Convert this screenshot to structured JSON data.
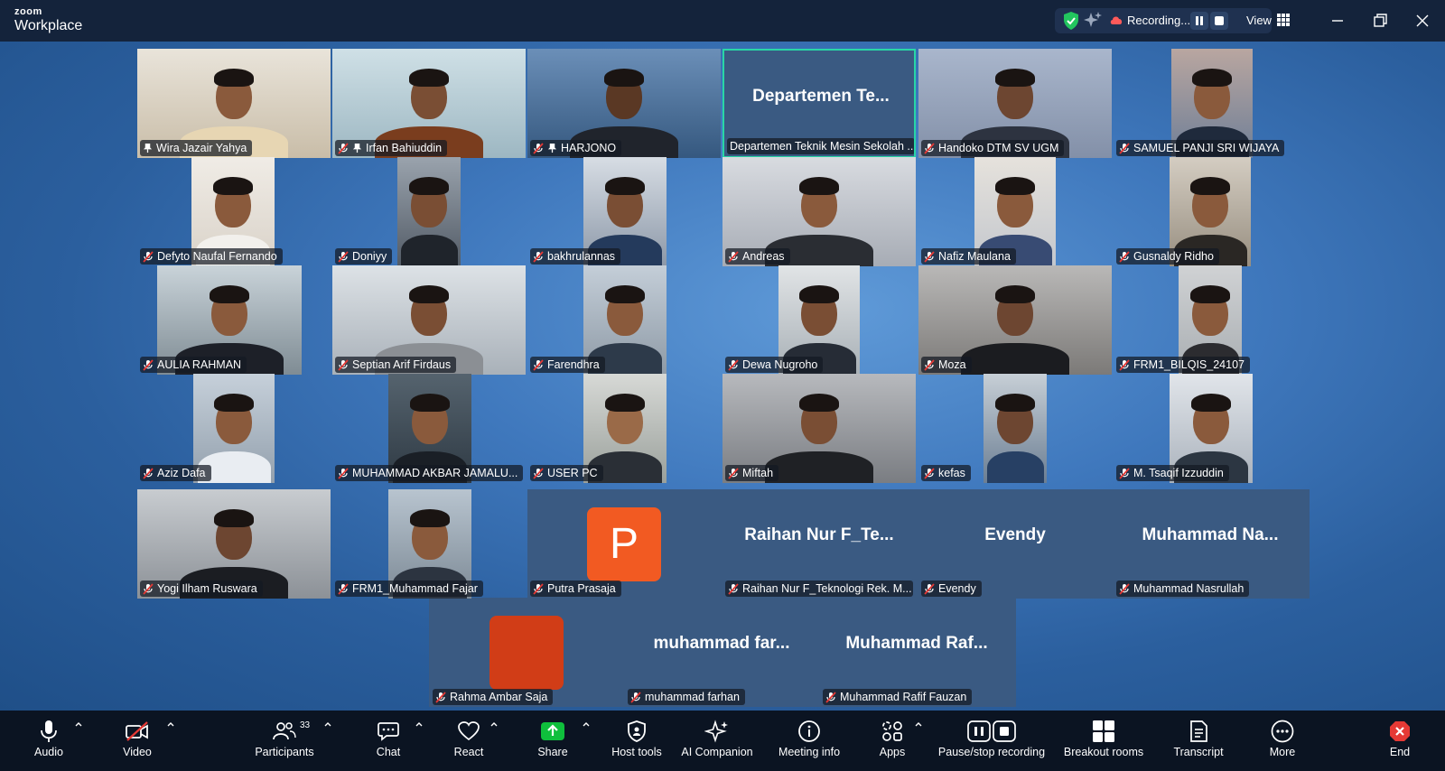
{
  "app": {
    "brand_top": "zoom",
    "brand_bottom": "Workplace"
  },
  "recording": {
    "status": "Recording...",
    "view_label": "View"
  },
  "participants": [
    {
      "name": "Wira Jazair Yahya",
      "pinned": true,
      "muted": false
    },
    {
      "name": "Irfan Bahiuddin",
      "pinned": true,
      "muted": true
    },
    {
      "name": "HARJONO",
      "pinned": true,
      "muted": true
    },
    {
      "name": "Departemen Teknik Mesin Sekolah ...",
      "display": "Departemen  Te...",
      "muted": false,
      "active_speaker": true
    },
    {
      "name": "Handoko DTM SV UGM",
      "muted": true
    },
    {
      "name": "SAMUEL PANJI SRI WIJAYA",
      "muted": true
    },
    {
      "name": "Defyto Naufal Fernando",
      "muted": true
    },
    {
      "name": "Doniyy",
      "muted": true
    },
    {
      "name": "bakhrulannas",
      "muted": true
    },
    {
      "name": "Andreas",
      "muted": true
    },
    {
      "name": "Nafiz Maulana",
      "muted": true
    },
    {
      "name": "Gusnaldy Ridho",
      "muted": true
    },
    {
      "name": "AULIA RAHMAN",
      "muted": true
    },
    {
      "name": "Septian Arif Firdaus",
      "muted": true
    },
    {
      "name": "Farendhra",
      "muted": true
    },
    {
      "name": "Dewa Nugroho",
      "muted": true
    },
    {
      "name": "Moza",
      "muted": true
    },
    {
      "name": "FRM1_BILQIS_24107",
      "muted": true
    },
    {
      "name": "Aziz Dafa",
      "muted": true
    },
    {
      "name": "MUHAMMAD AKBAR JAMALU...",
      "muted": true
    },
    {
      "name": "USER PC",
      "muted": true
    },
    {
      "name": "Miftah",
      "muted": true
    },
    {
      "name": "kefas",
      "muted": true
    },
    {
      "name": "M. Tsaqif Izzuddin",
      "muted": true
    },
    {
      "name": "Yogi Ilham Ruswara",
      "muted": true
    },
    {
      "name": "FRM1_Muhammad Fajar",
      "muted": true
    },
    {
      "name": "Putra Prasaja",
      "avatar_letter": "P",
      "muted": true
    },
    {
      "name": "Raihan Nur F_Teknologi Rek. M...",
      "display": "Raihan  Nur  F_Te...",
      "muted": true
    },
    {
      "name": "Evendy",
      "display": "Evendy",
      "muted": true
    },
    {
      "name": "Muhammad Nasrullah",
      "display": "Muhammad  Na...",
      "muted": true
    },
    {
      "name": "Rahma Ambar Saja",
      "muted": true
    },
    {
      "name": "muhammad farhan",
      "display": "muhammad  far...",
      "muted": true
    },
    {
      "name": "Muhammad Rafif Fauzan",
      "display": "Muhammad  Raf...",
      "muted": true
    }
  ],
  "toolbar": {
    "audio": "Audio",
    "video": "Video",
    "participants": "Participants",
    "participants_count": "33",
    "chat": "Chat",
    "react": "React",
    "share": "Share",
    "host_tools": "Host tools",
    "ai_companion": "AI Companion",
    "meeting_info": "Meeting info",
    "apps": "Apps",
    "pause_stop_recording": "Pause/stop recording",
    "breakout_rooms": "Breakout rooms",
    "transcript": "Transcript",
    "more": "More",
    "end": "End"
  },
  "colors": {
    "active_speaker_border": "#29d6a6",
    "share_green": "#0fbf3c",
    "end_red": "#e53935",
    "avatar_orange": "#f25a22",
    "avatar_red": "#d13d17"
  }
}
